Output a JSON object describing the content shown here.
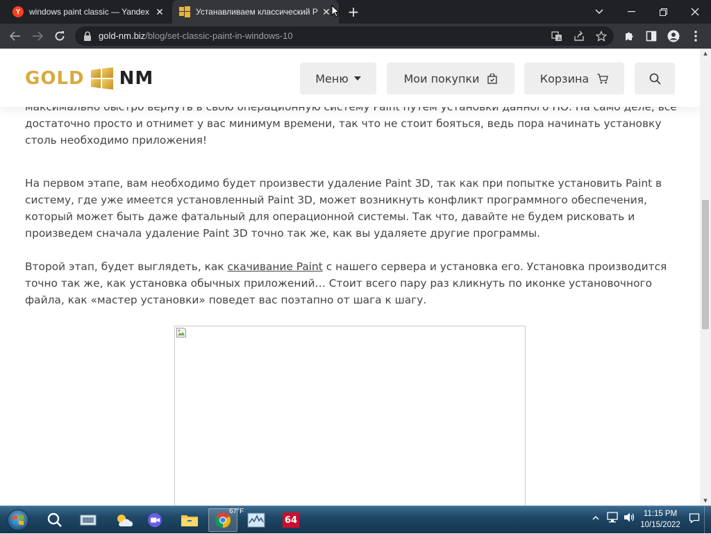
{
  "browser": {
    "tabs": [
      {
        "title": "windows paint classic — Yandex",
        "favicon": "yandex-icon",
        "active": false
      },
      {
        "title": "Устанавливаем классический Pa",
        "favicon": "windows-logo-icon",
        "active": true
      }
    ],
    "url_domain": "gold-nm.biz",
    "url_path": "/blog/set-classic-paint-in-windows-10"
  },
  "site": {
    "logo": {
      "left": "GOLD",
      "right": "NM"
    },
    "nav": {
      "menu_label": "Меню",
      "purchases_label": "Мои покупки",
      "cart_label": "Корзина"
    }
  },
  "article": {
    "p0": "максимально быстро вернуть в свою операционную систему Paint путем установки данного ПО. На само деле, все достаточно просто и отнимет у вас минимум времени, так что не стоит бояться, ведь пора начинать установку столь необходимо приложения!",
    "p1": "На первом этапе, вам необходимо будет произвести удаление Paint 3D, так как при попытке установить Paint в систему, где уже имеется установленный Paint 3D, может возникнуть конфликт программного обеспечения, который может быть даже фатальный для операционной системы. Так что, давайте не будем рисковать и произведем сначала удаление Paint 3D точно так же, как вы удаляете другие программы.",
    "p2_before": "Второй этап, будет выглядеть, как ",
    "p2_link": "скачивание Paint",
    "p2_after": " с нашего сервера и установка его. Установка производится точно так же, как установка обычных приложений… Стоит всего пару раз кликнуть по иконке установочного файла, как «мастер установки» поведет вас поэтапно от шага к шагу."
  },
  "taskbar": {
    "weather_temp": "67°F",
    "time": "11:15 PM",
    "date": "10/15/2022",
    "app_64_label": "64"
  },
  "colors": {
    "gold": "#d9a93c",
    "chrome_dark": "#202124",
    "chrome_toolbar": "#35363a",
    "taskbar": "#1f4766"
  }
}
